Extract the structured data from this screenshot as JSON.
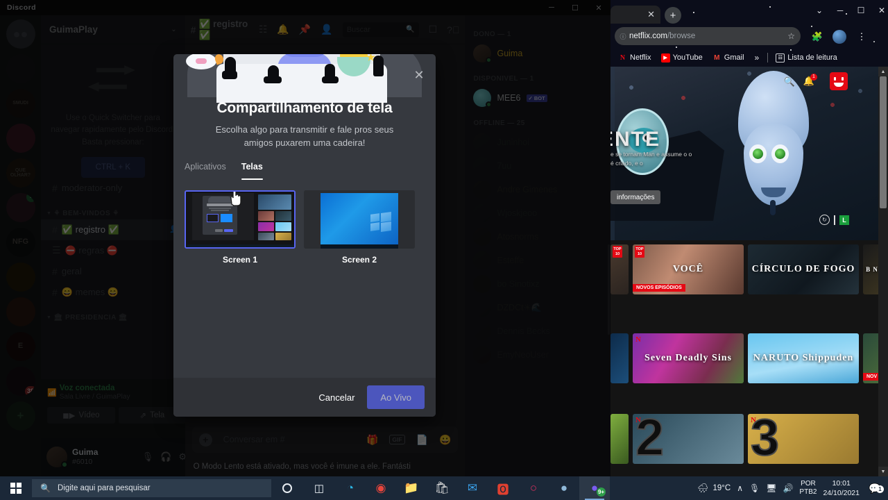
{
  "discord": {
    "window_title": "Discord",
    "window_controls": {
      "minimize": "─",
      "maximize": "☐",
      "close": "✕"
    },
    "guild_header": {
      "name": "GuimaPlay",
      "chevron": "⌄"
    },
    "quick_switcher": {
      "text": "Use o Quick Switcher para navegar rapidamente pelo Discord. Basta pressionar:",
      "key": "CTRL + K",
      "icon": "swap-arrows-icon"
    },
    "channels": [
      {
        "type": "channel",
        "name": "moderator-only",
        "icon": "hash-icon",
        "active": false
      },
      {
        "type": "category",
        "name": "⚘ BEM-VINDOS ⚘"
      },
      {
        "type": "channel",
        "name": "✅ registro ✅",
        "icon": "hash-icon",
        "active": true
      },
      {
        "type": "channel",
        "name": "⛔ regras ⛔",
        "icon": "rules-icon",
        "active": false
      },
      {
        "type": "channel",
        "name": "geral",
        "icon": "hash-icon",
        "active": false
      },
      {
        "type": "channel",
        "name": "😄 memes 😄",
        "icon": "hash-icon",
        "active": false
      },
      {
        "type": "category",
        "name": "🏛 PRESIDENCIA 🏛"
      }
    ],
    "voice_panel": {
      "status": "Voz conectada",
      "sub": "Sala Livre / GuimaPlay",
      "disconnect_icon": "disconnect-icon",
      "buttons": [
        {
          "label": "Vídeo",
          "icon": "camera-icon"
        },
        {
          "label": "Tela",
          "icon": "screen-share-icon"
        }
      ]
    },
    "user_bar": {
      "name": "Guima",
      "tag": "#6010",
      "icons": [
        "microphone-icon",
        "headphones-icon",
        "settings-gear-icon"
      ]
    },
    "topbar": {
      "channel_name": "✅ registro ✅",
      "icons": [
        "thread-icon",
        "bell-icon",
        "pin-icon",
        "members-icon"
      ],
      "search_placeholder": "Buscar",
      "inbox_icon": "inbox-icon",
      "help_icon": "help-icon"
    },
    "message_box": {
      "placeholder": "Conversar em #",
      "icons": [
        "gift-icon",
        "gif-icon",
        "sticker-icon",
        "emoji-icon"
      ],
      "gif_label": "GIF"
    },
    "slow_mode_notice": "O Modo Lento está ativado, mas você é imune a ele. Fantásti",
    "members": {
      "groups": [
        {
          "label": "DONO — 1",
          "people": [
            {
              "name": "Guima",
              "color": "#c9a227",
              "online": true,
              "bot": false
            }
          ]
        },
        {
          "label": "DISPONIVEL — 1",
          "people": [
            {
              "name": "MEE6",
              "color": "#b9bbbe",
              "online": true,
              "bot": true,
              "bot_label": "BOT"
            }
          ]
        },
        {
          "label": "OFFLINE — 25",
          "people": [
            {
              "name": "Juninhoi",
              "color": "#4f6b4f",
              "online": false,
              "bot": false
            },
            {
              "name": "7uu",
              "color": "#4e6b5c",
              "online": false,
              "bot": false
            },
            {
              "name": "Andre Gimenes",
              "color": "#6b6342",
              "online": false,
              "bot": false
            },
            {
              "name": "Wjoskjeoo",
              "color": "#4a6255",
              "online": false,
              "bot": false
            },
            {
              "name": "Atosnorms",
              "color": "#63604a",
              "online": false,
              "bot": false
            },
            {
              "name": "Esteffe",
              "color": "#5e5c46",
              "online": false,
              "bot": false
            },
            {
              "name": "bo Sinotixz",
              "color": "#4d5f50",
              "online": false,
              "bot": false
            },
            {
              "name": "DZDCt☀🌊",
              "color": "#64604b",
              "online": false,
              "bot": false
            },
            {
              "name": "Dennis Becks",
              "color": "#4f5a60",
              "online": false,
              "bot": false
            },
            {
              "name": "EmyNeoUser",
              "color": "#5b4f60",
              "online": false,
              "bot": false
            }
          ]
        }
      ]
    },
    "guild_rail": [
      {
        "name": "discord-home",
        "type": "home"
      },
      {
        "name": "server-dark-avatar",
        "label": ""
      },
      {
        "name": "server-smudi",
        "label": "SMUDI"
      },
      {
        "name": "server-pink",
        "label": ""
      },
      {
        "name": "server-oque-olhar",
        "label": "QUE OLHAR?"
      },
      {
        "name": "server-voice-active",
        "label": "",
        "voice": true
      },
      {
        "name": "server-nfg",
        "label": "NFG"
      },
      {
        "name": "server-star",
        "label": ""
      },
      {
        "name": "server-portrait",
        "label": ""
      },
      {
        "name": "server-e",
        "label": "E"
      },
      {
        "name": "server-badge",
        "label": "",
        "badge": "38"
      },
      {
        "name": "add-server",
        "label": "+"
      }
    ]
  },
  "modal": {
    "title": "Compartilhamento de tela",
    "subtitle": "Escolha algo para transmitir e fale pros seus amigos puxarem uma cadeira!",
    "close_icon": "close-icon",
    "tabs": [
      {
        "label": "Aplicativos",
        "active": false
      },
      {
        "label": "Telas",
        "active": true
      }
    ],
    "sources": [
      {
        "label": "Screen 1",
        "selected": true
      },
      {
        "label": "Screen 2",
        "selected": false
      }
    ],
    "cancel_label": "Cancelar",
    "live_label": "Ao Vivo",
    "accent_color": "#5865f2"
  },
  "chrome": {
    "url_host": "netflix.com",
    "url_path": "/browse",
    "tab_close_icon": "close-icon",
    "new_tab_icon": "plus-icon",
    "star_icon": "star-icon",
    "extensions_icon": "puzzle-icon",
    "profile_icon": "profile-avatar",
    "menu_icon": "kebab-menu-icon",
    "window_controls": {
      "chevron": "⌄",
      "minimize": "─",
      "maximize": "☐",
      "close": "✕"
    },
    "bookmarks": [
      {
        "label": "Netflix",
        "fav": "N",
        "fav_color": "#e50914"
      },
      {
        "label": "YouTube",
        "fav": "▶",
        "fav_color": "#ff0000"
      },
      {
        "label": "Gmail",
        "fav": "M",
        "fav_color": "#ea4335"
      }
    ],
    "bookmark_overflow": "»",
    "reading_list": "Lista de leitura",
    "reading_list_icon": "reading-list-icon"
  },
  "netflix": {
    "hero": {
      "title_fragment": "ENTE",
      "description": "e se tornam\nMan e assume o\no é criado, e o",
      "more_info_label": "informações",
      "maturity_rating": "L",
      "search_icon": "search-icon",
      "bell_icon": "bell-icon",
      "bell_count": "1",
      "avatar_icon": "netflix-profile-avatar"
    },
    "rows": [
      {
        "cards": [
          {
            "title": "",
            "top10": true,
            "badge": "",
            "bg": "linear-gradient(150deg,#4a3a2e,#2b2420)",
            "width": 26
          },
          {
            "title": "VOCÊ",
            "top10": true,
            "badge": "NOVOS EPISÓDIOS",
            "bg": "linear-gradient(120deg,#7d5a4a 0%,#c08b72 40%,#5a3a30 100%)",
            "width": 160,
            "netflix_n": true
          },
          {
            "title": "CÍRCULO DE FOGO",
            "top10": false,
            "badge": "",
            "bg": "linear-gradient(135deg,#1d2a33,#10181f 60%,#24323b)",
            "width": 160
          },
          {
            "title": "B N",
            "top10": false,
            "badge": "",
            "bg": "linear-gradient(135deg,#1a1a1a,#3a3320)",
            "width": 26
          }
        ]
      },
      {
        "cards": [
          {
            "title": "",
            "top10": false,
            "badge": "",
            "bg": "linear-gradient(135deg,#0d2b4a,#1c4e7a)",
            "width": 26
          },
          {
            "title": "Seven Deadly Sins",
            "top10": false,
            "badge": "",
            "bg": "linear-gradient(120deg,#7a2ea8 0%,#c0349e 35%,#7a2d4f 70%,#4f7a3a 100%)",
            "width": 160,
            "netflix_n": true
          },
          {
            "title": "NARUTO Shippuden",
            "top10": false,
            "badge": "",
            "bg": "linear-gradient(170deg,#68c6f0 0%,#a7def7 60%,#4aa7d8 100%)",
            "width": 160
          },
          {
            "title": "",
            "top10": false,
            "badge": "NOV",
            "bg": "linear-gradient(135deg,#2a4a3a,#4a6a3a)",
            "width": 26
          }
        ]
      },
      {
        "cards": [
          {
            "title": "",
            "top10": false,
            "badge": "",
            "bg": "linear-gradient(135deg,#7fae3f,#3a5a20)",
            "width": 26
          },
          {
            "title": "",
            "rank": "2",
            "bg": "linear-gradient(135deg,#2a4a5a,#6a8a9a)",
            "width": 160,
            "netflix_n": true
          },
          {
            "title": "",
            "rank": "3",
            "bg": "linear-gradient(135deg,#d8b04a,#9a7a30)",
            "width": 160,
            "netflix_n": true
          }
        ]
      }
    ]
  },
  "taskbar": {
    "start_icon": "windows-start-icon",
    "search_placeholder": "Digite aqui para pesquisar",
    "search_icon": "search-icon",
    "cortana_icon": "cortana-icon",
    "taskview_icon": "task-view-icon",
    "apps": [
      {
        "name": "edge-icon",
        "active": false
      },
      {
        "name": "chrome-icon",
        "active": false
      },
      {
        "name": "file-explorer-icon",
        "active": false
      },
      {
        "name": "microsoft-store-icon",
        "active": false
      },
      {
        "name": "mail-icon",
        "active": false
      },
      {
        "name": "office-icon",
        "active": false
      },
      {
        "name": "opera-icon",
        "active": false
      },
      {
        "name": "steam-icon",
        "active": false
      },
      {
        "name": "discord-icon",
        "active": true,
        "badge": "9+"
      }
    ],
    "tray": {
      "weather_icon": "rain-cloud-icon",
      "temperature": "19°C",
      "chevron": "∧",
      "mic_icon": "microphone-icon",
      "network_icon": "network-icon",
      "volume_icon": "volume-icon",
      "lang_line1": "POR",
      "lang_line2": "PTB2",
      "time": "10:01",
      "date": "24/10/2021",
      "action_center_icon": "action-center-icon",
      "action_center_badge": "1"
    }
  }
}
